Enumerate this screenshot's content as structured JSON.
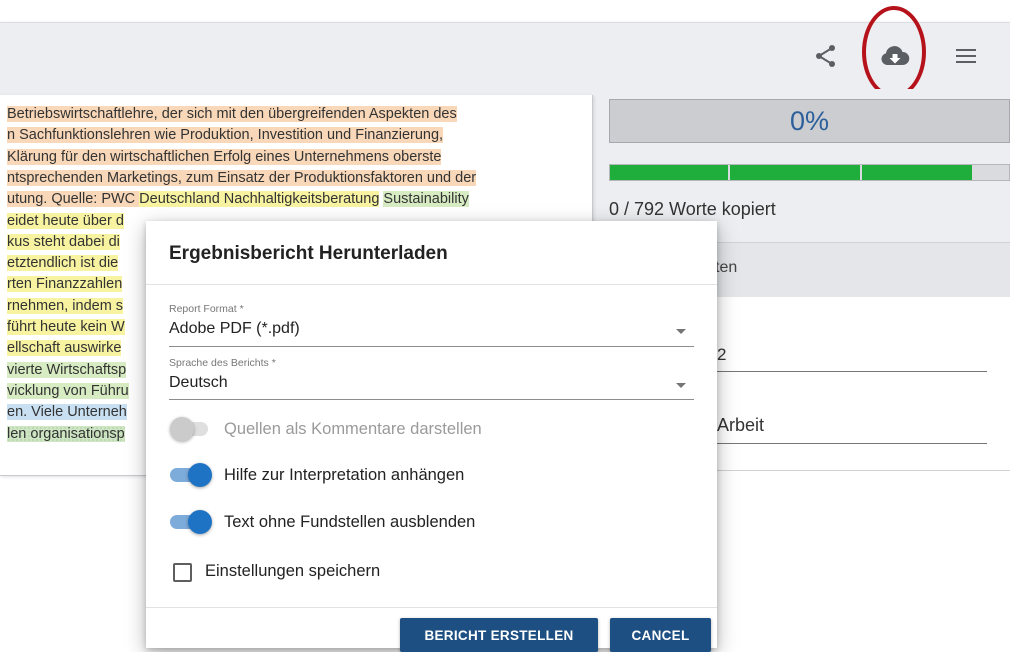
{
  "toolbar": {
    "share_icon": "share-icon",
    "download_icon": "cloud-download-icon",
    "menu_icon": "hamburger-menu-icon"
  },
  "document": {
    "lines": [
      [
        {
          "t": "Betriebswirtschaftlehre, der sich mit den übergreifenden Aspekten des",
          "h": "o"
        }
      ],
      [
        {
          "t": "n Sachfunktionslehren wie Produktion, Investition und Finanzierung,",
          "h": "o"
        }
      ],
      [
        {
          "t": " Klärung für den wirtschaftlichen Erfolg eines Unternehmens oberste",
          "h": "o"
        }
      ],
      [
        {
          "t": "ntsprechenden Marketings, zum Einsatz der Produktionsfaktoren und der",
          "h": "o"
        }
      ],
      [
        {
          "t": "utung. Quelle: PWC ",
          "h": "o"
        },
        {
          "t": "Deutschland Nachhaltigkeitsberatung",
          "h": "y"
        },
        {
          "t": " ",
          "h": ""
        },
        {
          "t": "Sustainability",
          "h": "g"
        }
      ],
      [
        {
          "t": "eidet heute über d",
          "h": "y"
        }
      ],
      [
        {
          "t": "kus steht dabei di",
          "h": "y"
        }
      ],
      [
        {
          "t": "etztendlich ist die",
          "h": "y"
        }
      ],
      [
        {
          "t": "rten Finanzzahlen",
          "h": "y"
        }
      ],
      [
        {
          "t": "rnehmen, indem s",
          "h": "y"
        }
      ],
      [
        {
          "t": "führt heute kein W",
          "h": "y"
        }
      ],
      [
        {
          "t": "ellschaft auswirke",
          "h": "y"
        }
      ],
      [
        {
          "t": "vierte Wirtschaftsp",
          "h": "g"
        }
      ],
      [
        {
          "t": "vicklung von Führu",
          "h": "g"
        }
      ],
      [
        {
          "t": "en. Viele Unterneh",
          "h": "b"
        }
      ],
      [
        {
          "t": "len organisationsp",
          "h": "gd"
        }
      ]
    ]
  },
  "right_panel": {
    "percent": "0%",
    "progress_segments": [
      0.3,
      0.33,
      0.28
    ],
    "words_copied": "0 / 792 Worte kopiert",
    "card_header": "ten",
    "card_field_1": "2",
    "card_field_2": "Arbeit"
  },
  "dialog": {
    "title": "Ergebnisbericht Herunterladen",
    "report_format_label": "Report Format *",
    "report_format_value": "Adobe PDF (*.pdf)",
    "language_label": "Sprache des Berichts *",
    "language_value": "Deutsch",
    "toggles": [
      {
        "label": "Quellen als Kommentare darstellen",
        "on": false,
        "disabled": true
      },
      {
        "label": "Hilfe zur Interpretation anhängen",
        "on": true,
        "disabled": false
      },
      {
        "label": "Text ohne Fundstellen ausblenden",
        "on": true,
        "disabled": false
      }
    ],
    "save_settings_label": "Einstellungen speichern",
    "save_settings_checked": false,
    "create_button": "BERICHT ERSTELLEN",
    "cancel_button": "CANCEL"
  },
  "colors": {
    "accent": "#1e4f82",
    "toggle_on": "#1f73c5",
    "progress": "#1fae3c",
    "annotation_circle": "#b5121b"
  }
}
